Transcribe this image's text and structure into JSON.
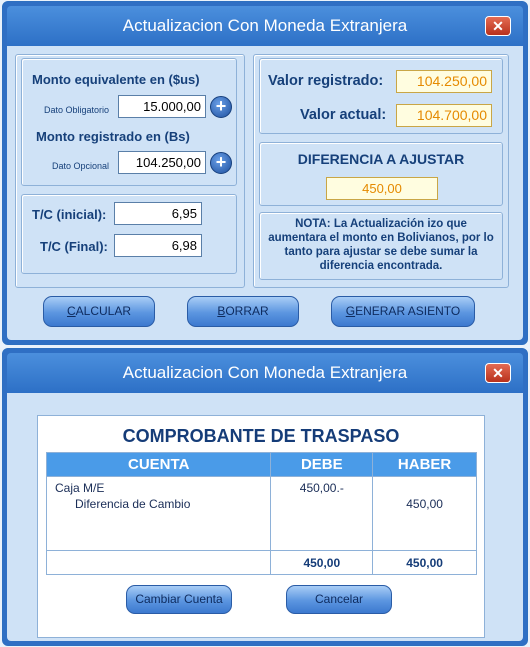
{
  "window1": {
    "title": "Actualizacion Con Moneda Extranjera",
    "close_label": "✕",
    "monto_equivalente_label": "Monto equivalente en ($us)",
    "dato_obligatorio_label": "Dato Obligatorio",
    "monto_equivalente_value": "15.000,00",
    "monto_registrado_label": "Monto registrado en (Bs)",
    "dato_opcional_label": "Dato Opcional",
    "monto_registrado_value": "104.250,00",
    "plus_label": "+",
    "tc_inicial_label": "T/C (inicial):",
    "tc_inicial_value": "6,95",
    "tc_final_label": "T/C (Final):",
    "tc_final_value": "6,98",
    "valor_registrado_label": "Valor registrado:",
    "valor_registrado_value": "104.250,00",
    "valor_actual_label": "Valor actual:",
    "valor_actual_value": "104.700,00",
    "diferencia_label": "DIFERENCIA A AJUSTAR",
    "diferencia_value": "450,00",
    "note_text": "NOTA: La Actualización izo que aumentara el monto en Bolivianos, por lo tanto para ajustar se debe sumar la diferencia encontrada.",
    "buttons": {
      "calcular": "CALCULAR",
      "borrar": "BORRAR",
      "generar": "GENERAR ASIENTO"
    }
  },
  "window2": {
    "title": "Actualizacion Con Moneda Extranjera",
    "close_label": "✕",
    "voucher_title": "COMPROBANTE DE TRASPASO",
    "columns": {
      "cuenta": "CUENTA",
      "debe": "DEBE",
      "haber": "HABER"
    },
    "rows": [
      {
        "cuenta": "Caja M/E",
        "debe": "450,00.-",
        "haber": ""
      },
      {
        "cuenta": "Diferencia de Cambio",
        "debe": "",
        "haber": "450,00"
      }
    ],
    "totals": {
      "debe": "450,00",
      "haber": "450,00"
    },
    "buttons": {
      "cambiar": "Cambiar Cuenta",
      "cancelar": "Cancelar"
    }
  }
}
